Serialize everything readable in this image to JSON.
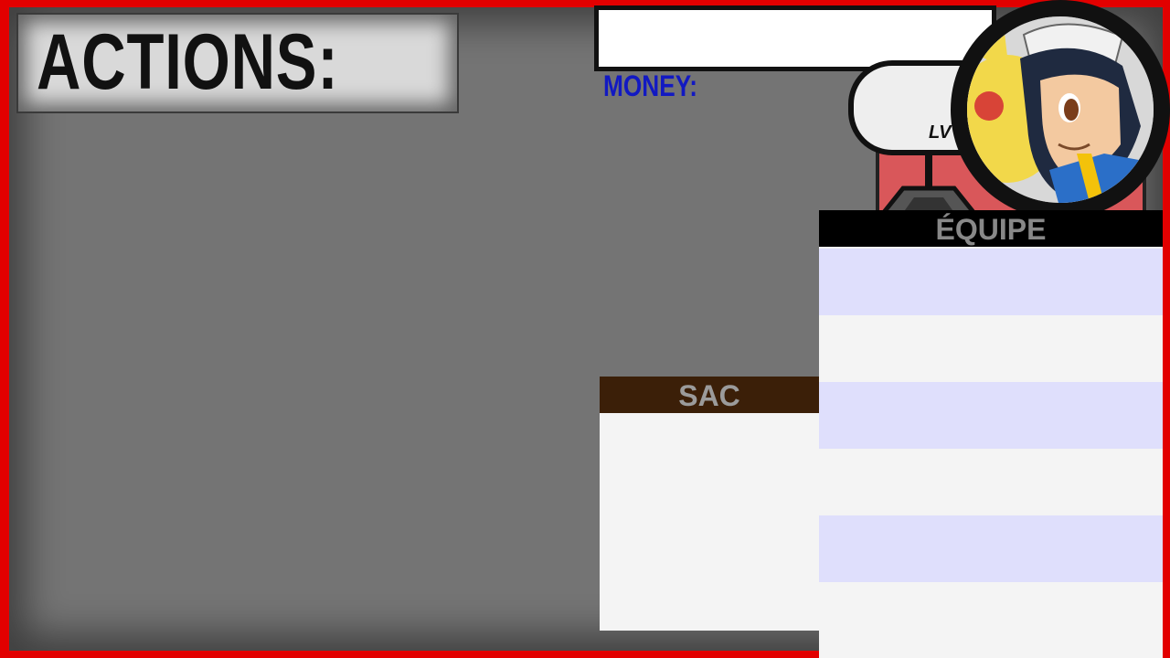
{
  "actions": {
    "title": "ACTIONS:"
  },
  "money": {
    "label": "MONEY:"
  },
  "level": {
    "label": "LV"
  },
  "team": {
    "title": "ÉQUIPE",
    "rows": [
      "",
      "",
      "",
      "",
      "",
      ""
    ]
  },
  "bag": {
    "title": "SAC"
  },
  "colors": {
    "frame": "#e20000",
    "background": "#747474",
    "money_text": "#1219c2",
    "team_row_tint": "#dfdffc",
    "bag_header": "#3b1f08",
    "trainer_panel": "#d9575a"
  }
}
